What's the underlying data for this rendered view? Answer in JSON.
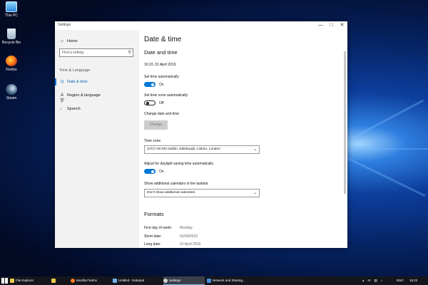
{
  "desktop": {
    "icons": [
      {
        "label": "This PC",
        "icon": "this-pc-icon"
      },
      {
        "label": "Recycle Bin",
        "icon": "recycle-bin-icon"
      },
      {
        "label": "Firefox",
        "icon": "firefox-icon"
      },
      {
        "label": "Steam",
        "icon": "steam-icon"
      }
    ]
  },
  "window": {
    "title": "Settings",
    "controls": {
      "minimize": "—",
      "maximize": "□",
      "close": "✕"
    }
  },
  "sidebar": {
    "home": {
      "label": "Home",
      "icon": "⌂"
    },
    "search_placeholder": "Find a setting",
    "search_icon": "⚲",
    "section": "Time & Language",
    "items": [
      {
        "label": "Date & time",
        "icon": "◷",
        "active": true
      },
      {
        "label": "Region & language",
        "icon": "A字",
        "active": false
      },
      {
        "label": "Speech",
        "icon": "♩",
        "active": false
      }
    ]
  },
  "content": {
    "page_title": "Date & time",
    "date_time_section": "Date and time",
    "current_datetime": "16:23, 01 April 2019",
    "set_time_auto": {
      "label": "Set time automatically",
      "state": "On",
      "on": true
    },
    "set_timezone_auto": {
      "label": "Set time zone automatically",
      "state": "Off",
      "on": false
    },
    "change_datetime": {
      "label": "Change date and time",
      "button": "Change",
      "enabled": false
    },
    "time_zone": {
      "label": "Time zone",
      "value": "(UTC+00:00) Dublin, Edinburgh, Lisbon, London"
    },
    "daylight_saving": {
      "label": "Adjust for daylight saving time automatically",
      "state": "On",
      "on": true
    },
    "calendars": {
      "label": "Show additional calendars in the taskbar",
      "value": "Don't show additional calendars"
    },
    "formats_section": "Formats",
    "formats": [
      {
        "label": "First day of week:",
        "value": "Monday"
      },
      {
        "label": "Short date:",
        "value": "01/04/2019"
      },
      {
        "label": "Long date:",
        "value": "01 April 2019"
      }
    ]
  },
  "taskbar": {
    "items": [
      {
        "label": "File Explorer",
        "color": "#f2c94c",
        "active": false
      },
      {
        "label": "",
        "color": "#f2c94c",
        "active": false
      },
      {
        "label": "Mozilla Firefox",
        "color": "#ff7b1c",
        "active": false
      },
      {
        "label": "Untitled - Notepad",
        "color": "#6fb3e8",
        "active": false
      },
      {
        "label": "Settings",
        "color": "#cfcfcf",
        "active": true
      },
      {
        "label": "Network and Sharing...",
        "color": "#4a90d9",
        "active": false
      }
    ],
    "tray_icons": "▴ ✉ ▤ ♪",
    "language": "ENG",
    "time": "16:22"
  },
  "colors": {
    "accent": "#0078d7",
    "active_nav": "#0063b1",
    "sidebar_bg": "#f2f2f2",
    "taskbar_bg": "#14161c"
  }
}
